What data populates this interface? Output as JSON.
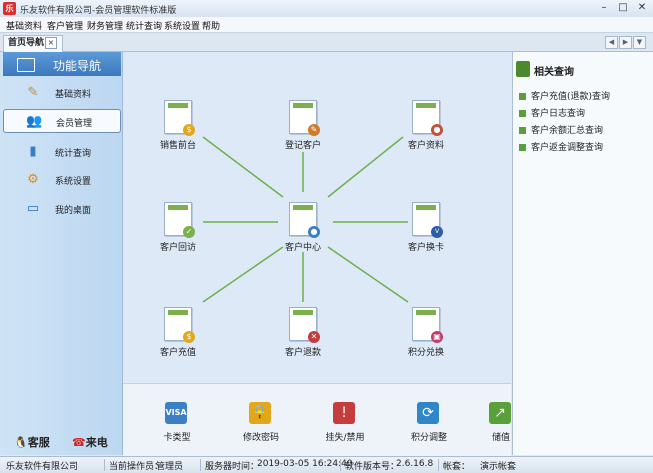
{
  "window": {
    "title": "乐友软件有限公司-会员管理软件标准版",
    "icon_text": "乐"
  },
  "menu": [
    "基础资料",
    "客户管理",
    "财务管理",
    "统计查询",
    "系统设置",
    "帮助"
  ],
  "tab": {
    "label": "首页导航"
  },
  "nav": {
    "header": "功能导航",
    "items": [
      {
        "label": "基础资料",
        "icon": "pencil-icon"
      },
      {
        "label": "会员管理",
        "icon": "users-icon",
        "active": true
      },
      {
        "label": "统计查询",
        "icon": "bar-chart-icon"
      },
      {
        "label": "系统设置",
        "icon": "gear-icon"
      },
      {
        "label": "我的桌面",
        "icon": "desktop-icon"
      }
    ],
    "bottom": {
      "service": "客服",
      "phone": "来电"
    }
  },
  "flow": {
    "nodes": [
      {
        "label": "销售前台"
      },
      {
        "label": "登记客户"
      },
      {
        "label": "客户资料"
      },
      {
        "label": "客户回访"
      },
      {
        "label": "客户中心"
      },
      {
        "label": "客户换卡"
      },
      {
        "label": "客户充值"
      },
      {
        "label": "客户退款"
      },
      {
        "label": "积分兑换"
      }
    ]
  },
  "shortcuts": [
    {
      "label": "卡类型",
      "icon": "visa-card-icon",
      "color": "#3d7fc4"
    },
    {
      "label": "修改密码",
      "icon": "lock-icon",
      "color": "#e2a81c"
    },
    {
      "label": "挂失/禁用",
      "icon": "user-block-icon",
      "color": "#c43c3c"
    },
    {
      "label": "积分调整",
      "icon": "refresh-icon",
      "color": "#2f86c9"
    },
    {
      "label": "储值",
      "icon": "wallet-icon",
      "color": "#5aa03a"
    }
  ],
  "related": {
    "title": "相关查询",
    "links": [
      "客户充值(退款)查询",
      "客户日志查询",
      "客户余额汇总查询",
      "客户返金调整查询"
    ]
  },
  "status": {
    "company": "乐友软件有限公司",
    "operator_label": "当前操作员：",
    "operator": "管理员",
    "server_time_label": "服务器时间：",
    "server_time": "2019-03-05 16:24:40",
    "version_label": "软件版本号：",
    "version": "2.6.16.8",
    "account_label": "帐套：",
    "account": "演示帐套"
  },
  "colors": {
    "accent": "#3c78bd",
    "link_line": "#6ab04c"
  }
}
